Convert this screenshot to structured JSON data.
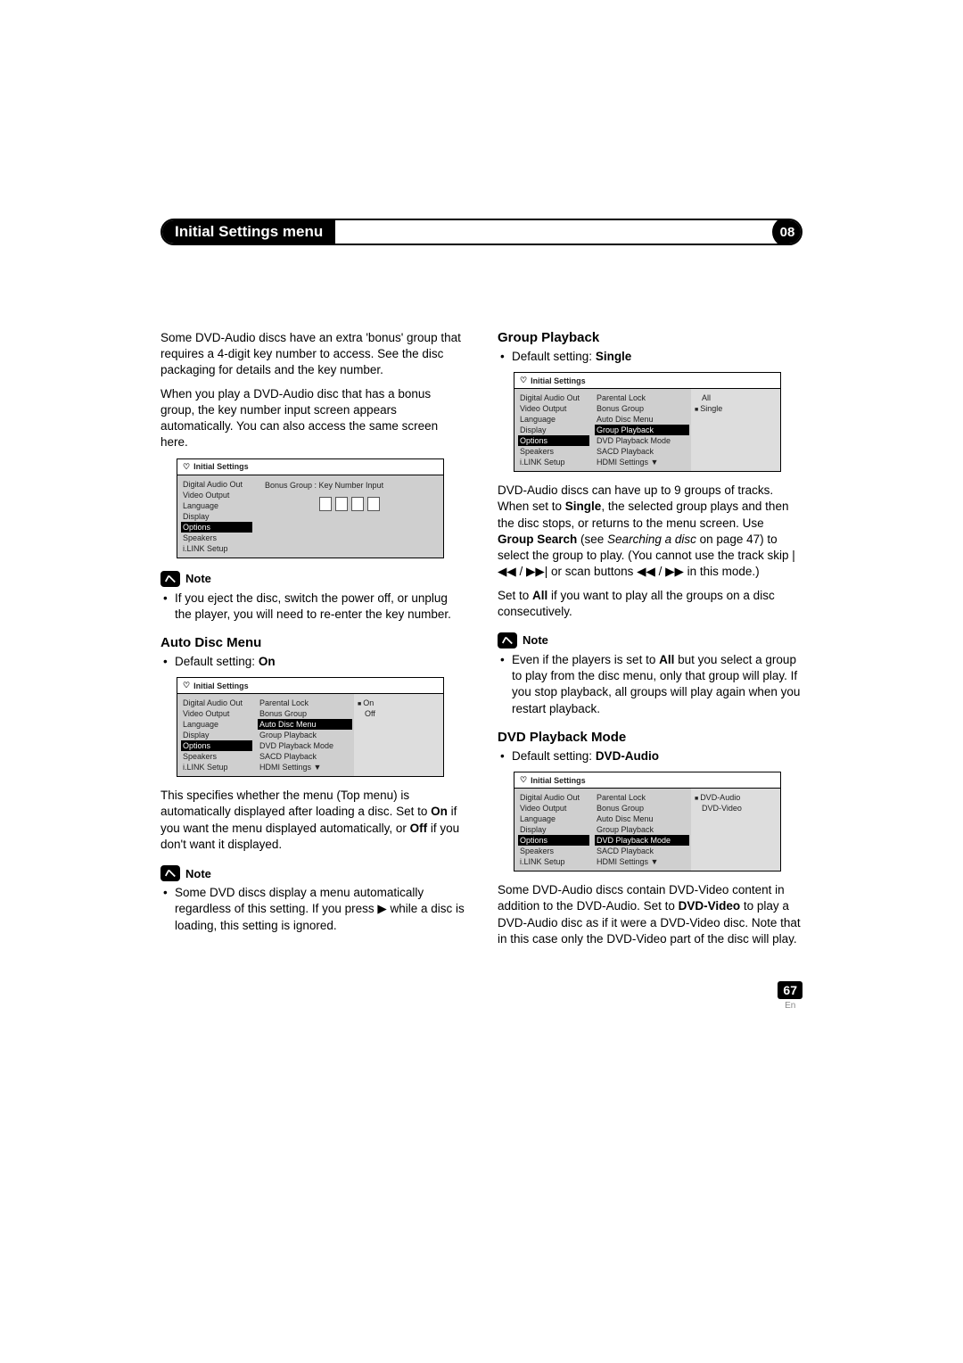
{
  "header": {
    "title": "Initial Settings menu",
    "chapter": "08"
  },
  "left": {
    "p1": "Some DVD-Audio discs have an extra 'bonus' group that requires a 4-digit key number to access. See the disc packaging for details and the key number.",
    "p2": "When you play a DVD-Audio disc that has a bonus group, the key number input screen appears automatically. You can also access the same screen here.",
    "note1_label": "Note",
    "note1_text": "If you eject the disc, switch the power off, or unplug the player, you will need to re-enter the key number.",
    "h_auto": "Auto Disc Menu",
    "auto_default_prefix": "Default setting: ",
    "auto_default_value": "On",
    "auto_para_a": "This specifies whether the menu (Top menu) is automatically displayed after loading a disc. Set to ",
    "auto_para_b": " if you want the menu displayed automatically, or ",
    "auto_para_c": " if you don't want it displayed.",
    "auto_on": "On",
    "auto_off": "Off",
    "note2_label": "Note",
    "note2_text": "Some DVD discs display a menu automatically regardless of this setting. If you press ▶ while a disc is loading, this setting is ignored."
  },
  "right": {
    "h_group": "Group Playback",
    "group_default_prefix": "Default setting: ",
    "group_default_value": "Single",
    "group_p1a": "DVD-Audio discs can have up to 9 groups of tracks. When set to ",
    "group_single": "Single",
    "group_p1b": ", the selected group plays and then the disc stops, or returns to the menu screen. Use ",
    "group_search": "Group Search",
    "group_p1c": " (see ",
    "group_italic": "Searching a disc",
    "group_p1d": " on page 47) to select the group to play. (You cannot use the track skip |◀◀ / ▶▶| or scan buttons ◀◀ / ▶▶ in this mode.)",
    "group_p2a": "Set to ",
    "group_all": "All",
    "group_p2b": " if you want to play all the groups on a disc consecutively.",
    "note3_label": "Note",
    "note3_text_a": "Even if the players is set to ",
    "note3_all": "All",
    "note3_text_b": " but you select a group to play from the disc menu, only that group will play. If you stop playback, all groups will play again when you restart playback.",
    "h_dvd": "DVD Playback Mode",
    "dvd_default_prefix": "Default setting: ",
    "dvd_default_value": "DVD-Audio",
    "dvd_p1a": "Some DVD-Audio discs contain DVD-Video content in addition to the DVD-Audio. Set to ",
    "dvd_video": "DVD-Video",
    "dvd_p1b": " to play a DVD-Audio disc as if it were a DVD-Video disc. Note that in this case only the DVD-Video part of the disc will play."
  },
  "ss_common": {
    "title": "Initial Settings",
    "left_items": [
      "Digital Audio Out",
      "Video Output",
      "Language",
      "Display",
      "Options",
      "Speakers",
      "i.LINK Setup"
    ],
    "mid_items": [
      "Parental Lock",
      "Bonus Group",
      "Auto Disc Menu",
      "Group Playback",
      "DVD Playback Mode",
      "SACD Playback",
      "HDMI Settings"
    ]
  },
  "ss1": {
    "right_label": "Bonus Group : Key Number Input"
  },
  "ss2": {
    "hl_left": "Options",
    "hl_mid": "Auto Disc Menu",
    "right": [
      "On",
      "Off"
    ],
    "sel": "On"
  },
  "ss3": {
    "hl_left": "Options",
    "hl_mid": "Group Playback",
    "right": [
      "All",
      "Single"
    ],
    "sel": "Single"
  },
  "ss4": {
    "hl_left": "Options",
    "hl_mid": "DVD Playback Mode",
    "right": [
      "DVD-Audio",
      "DVD-Video"
    ],
    "sel": "DVD-Audio"
  },
  "page": {
    "num": "67",
    "lang": "En"
  }
}
